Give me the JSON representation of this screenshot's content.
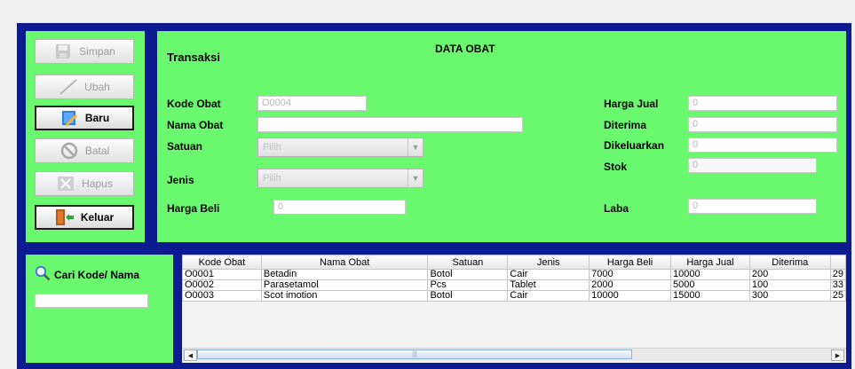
{
  "buttons": {
    "simpan": "Simpan",
    "ubah": "Ubah",
    "baru": "Baru",
    "batal": "Batal",
    "hapus": "Hapus",
    "keluar": "Keluar"
  },
  "form": {
    "section_title": "Transaksi",
    "header_title": "DATA OBAT",
    "kode_obat_label": "Kode Obat",
    "kode_obat_value": "O0004",
    "nama_obat_label": "Nama Obat",
    "nama_obat_value": "",
    "satuan_label": "Satuan",
    "satuan_selected": "Pilih",
    "jenis_label": "Jenis",
    "jenis_selected": "Pilih",
    "harga_beli_label": "Harga Beli",
    "harga_beli_value": "0",
    "harga_jual_label": "Harga Jual",
    "harga_jual_value": "0",
    "diterima_label": "Diterima",
    "diterima_value": "0",
    "dikeluarkan_label": "Dikeluarkan",
    "dikeluarkan_value": "0",
    "stok_label": "Stok",
    "stok_value": "0",
    "laba_label": "Laba",
    "laba_value": "0"
  },
  "search": {
    "label": "Cari Kode/ Nama",
    "value": ""
  },
  "table": {
    "columns": [
      "Kode Obat",
      "Nama Obat",
      "Satuan",
      "Jenis",
      "Harga Beli",
      "Harga Jual",
      "Diterima"
    ],
    "overflow_header": "",
    "rows": [
      {
        "kode": "O0001",
        "nama": "Betadin",
        "satuan": "Botol",
        "jenis": "Cair",
        "harga_beli": "7000",
        "harga_jual": "10000",
        "diterima": "200",
        "extra": "29"
      },
      {
        "kode": "O0002",
        "nama": "Parasetamol",
        "satuan": "Pcs",
        "jenis": "Tablet",
        "harga_beli": "2000",
        "harga_jual": "5000",
        "diterima": "100",
        "extra": "33"
      },
      {
        "kode": "O0003",
        "nama": "Scot imotion",
        "satuan": "Botol",
        "jenis": "Cair",
        "harga_beli": "10000",
        "harga_jual": "15000",
        "diterima": "300",
        "extra": "25"
      }
    ]
  },
  "icons": {
    "simpan": "save-disk-icon",
    "ubah": "pencil-line-icon",
    "baru": "new-document-icon",
    "batal": "cancel-circle-icon",
    "hapus": "delete-x-icon",
    "keluar": "exit-door-icon",
    "search": "magnifier-icon"
  },
  "colors": {
    "panel_green": "#6af86f",
    "frame_blue": "#0c1b8f"
  }
}
